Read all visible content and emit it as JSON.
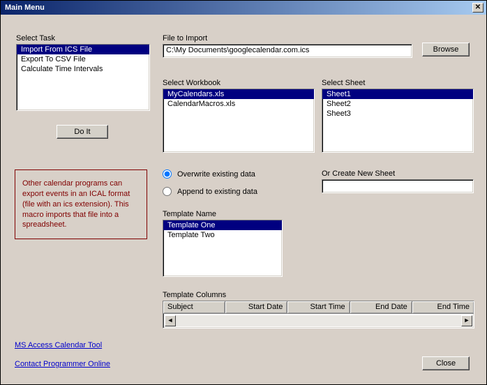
{
  "window": {
    "title": "Main Menu"
  },
  "labels": {
    "select_task": "Select Task",
    "file_to_import": "File to Import",
    "select_workbook": "Select Workbook",
    "select_sheet": "Select Sheet",
    "or_create_new_sheet": "Or Create New Sheet",
    "template_name": "Template Name",
    "template_columns": "Template Columns"
  },
  "buttons": {
    "browse": "Browse",
    "do_it": "Do It",
    "close": "Close"
  },
  "task_list": {
    "items": [
      "Import From ICS File",
      "Export To CSV File",
      "Calculate Time Intervals"
    ],
    "selected_index": 0
  },
  "file_to_import": "C:\\My Documents\\googlecalendar.com.ics",
  "workbooks": {
    "items": [
      "MyCalendars.xls",
      "CalendarMacros.xls"
    ],
    "selected_index": 0
  },
  "sheets": {
    "items": [
      "Sheet1",
      "Sheet2",
      "Sheet3"
    ],
    "selected_index": 0
  },
  "new_sheet_value": "",
  "mode": {
    "overwrite_label": "Overwrite existing data",
    "append_label": "Append to existing data",
    "selected": "overwrite"
  },
  "templates": {
    "items": [
      "Template One",
      "Template Two"
    ],
    "selected_index": 0
  },
  "template_columns": [
    "Subject",
    "Start Date",
    "Start Time",
    "End Date",
    "End Time"
  ],
  "description": "Other calendar programs can export events in an ICAL format (file with an ics extension). This macro imports that file into a spreadsheet.",
  "links": {
    "access_tool": "MS Access Calendar Tool",
    "contact": "Contact Programmer Online"
  }
}
